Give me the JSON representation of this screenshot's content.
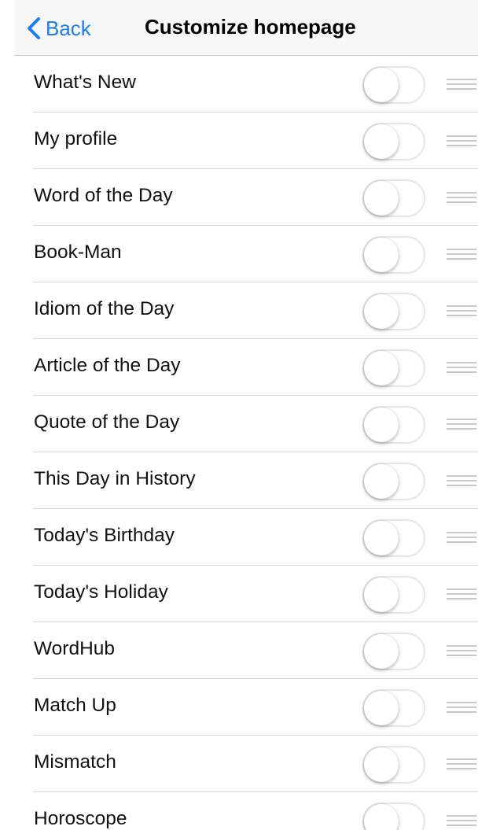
{
  "navbar": {
    "back_label": "Back",
    "back_icon": "chevron-left-icon",
    "title": "Customize homepage"
  },
  "colors": {
    "accent": "#1a7cf6",
    "navbar_bg": "#f7f7f7",
    "separator": "#d6d6d6",
    "toggle_off_border": "#e6e6e6",
    "drag_handle": "#c8c8cc"
  },
  "items": [
    {
      "label": "What's New",
      "enabled": false
    },
    {
      "label": "My profile",
      "enabled": false
    },
    {
      "label": "Word of the Day",
      "enabled": false
    },
    {
      "label": "Book-Man",
      "enabled": false
    },
    {
      "label": "Idiom of the Day",
      "enabled": false
    },
    {
      "label": "Article of the Day",
      "enabled": false
    },
    {
      "label": "Quote of the Day",
      "enabled": false
    },
    {
      "label": "This Day in History",
      "enabled": false
    },
    {
      "label": "Today's Birthday",
      "enabled": false
    },
    {
      "label": "Today's Holiday",
      "enabled": false
    },
    {
      "label": "WordHub",
      "enabled": false
    },
    {
      "label": "Match Up",
      "enabled": false
    },
    {
      "label": "Mismatch",
      "enabled": false
    },
    {
      "label": "Horoscope",
      "enabled": false
    }
  ]
}
